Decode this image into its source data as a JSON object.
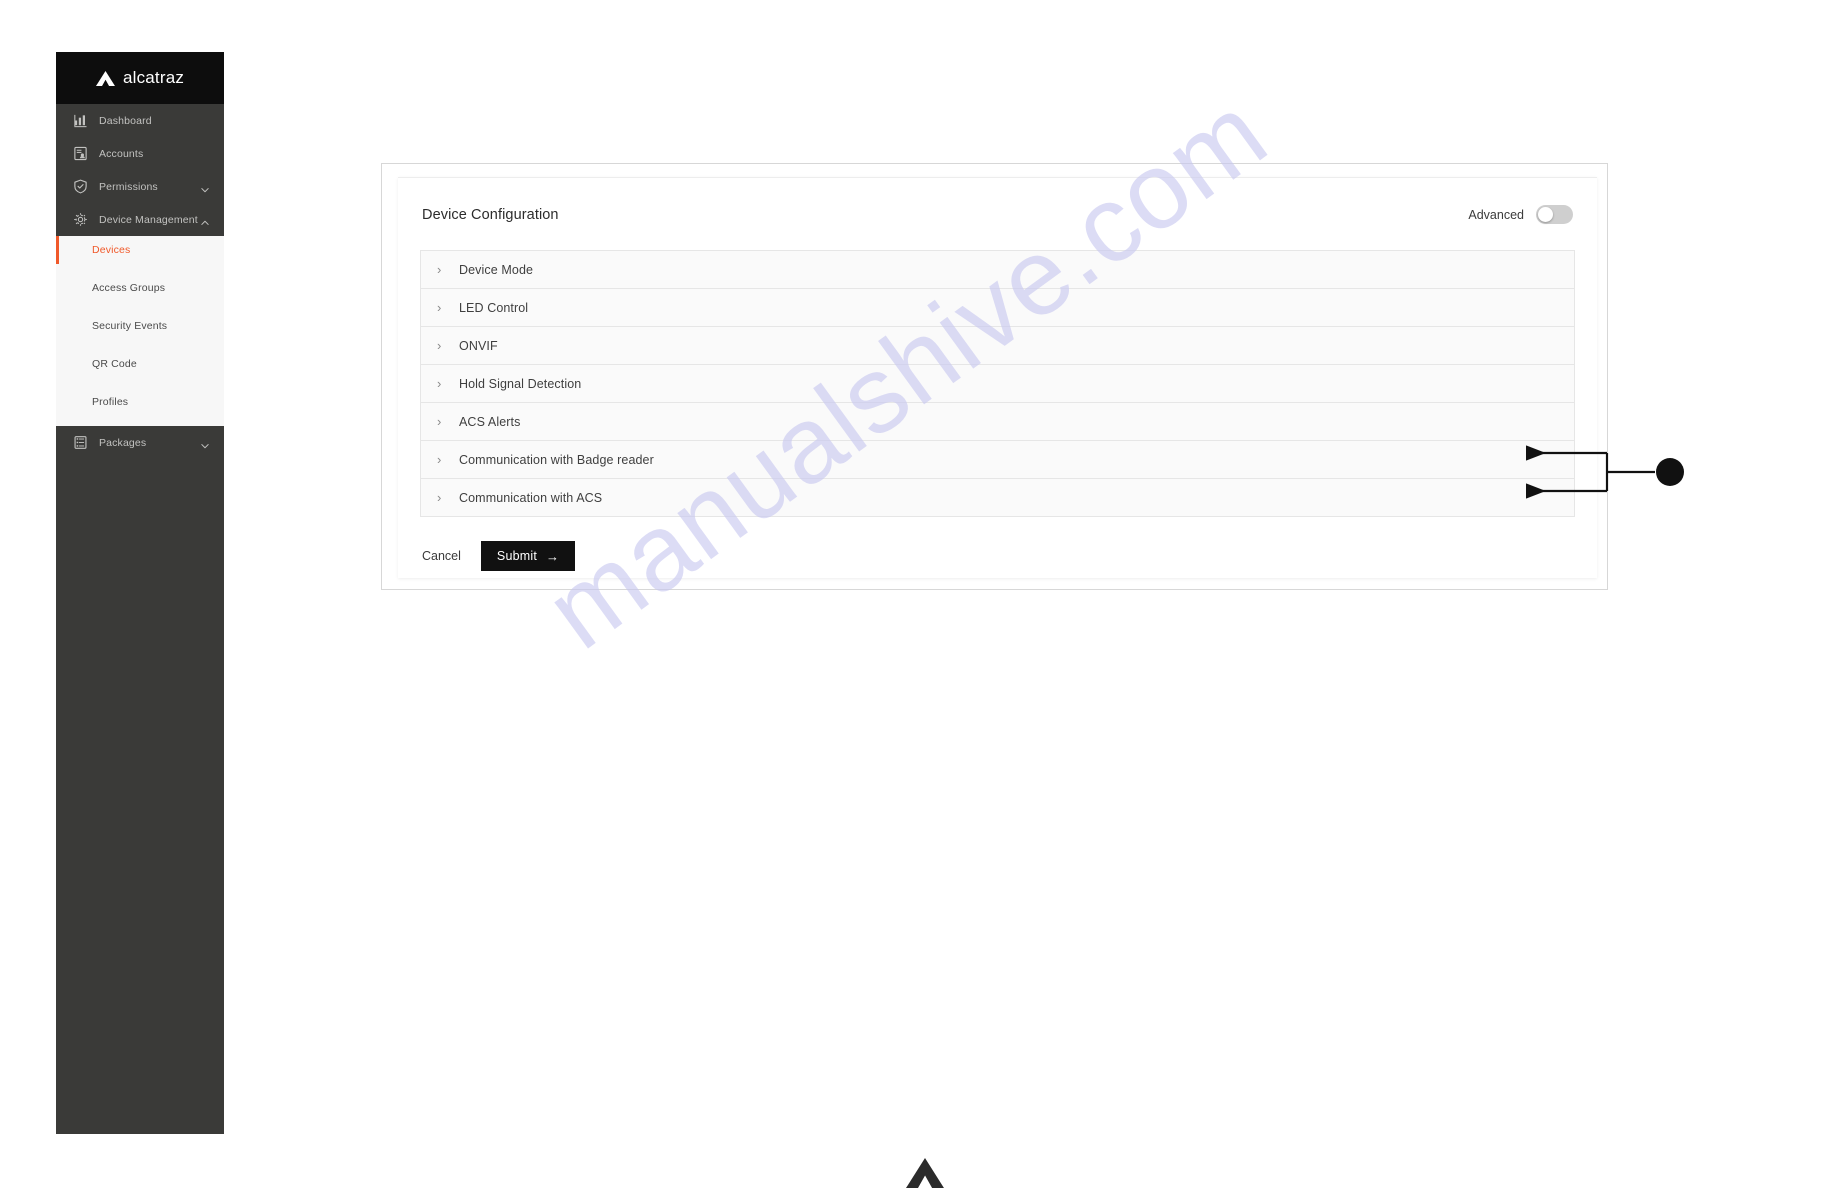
{
  "brand": {
    "name": "alcatraz",
    "logo_icon": "alcatraz-a-mark"
  },
  "watermark": {
    "text": "manualshive.com",
    "color": "#c8c8f0"
  },
  "sidebar": {
    "items": [
      {
        "label": "Dashboard",
        "icon": "bar-chart-icon",
        "caret": "",
        "name": "dashboard"
      },
      {
        "label": "Accounts",
        "icon": "account-card-icon",
        "caret": "",
        "name": "accounts"
      },
      {
        "label": "Permissions",
        "icon": "shield-check-icon",
        "caret": "⌄",
        "name": "permissions"
      },
      {
        "label": "Device Management",
        "icon": "gear-icon",
        "caret": "⌃",
        "name": "device-management"
      }
    ],
    "submenu": [
      {
        "label": "Devices",
        "active": true,
        "name": "devices"
      },
      {
        "label": "Access Groups",
        "active": false,
        "name": "access-groups"
      },
      {
        "label": "Security Events",
        "active": false,
        "name": "security-events"
      },
      {
        "label": "QR Code",
        "active": false,
        "name": "qr-code"
      },
      {
        "label": "Profiles",
        "active": false,
        "name": "profiles"
      }
    ],
    "packages": {
      "label": "Packages",
      "icon": "stack-list-icon",
      "caret": "⌄",
      "name": "packages"
    },
    "active_color": "#f0592a"
  },
  "card": {
    "title": "Device Configuration",
    "advanced": {
      "label": "Advanced",
      "enabled": false
    },
    "sections": [
      {
        "label": "Device Mode",
        "expanded": false
      },
      {
        "label": "LED Control",
        "expanded": false
      },
      {
        "label": "ONVIF",
        "expanded": false
      },
      {
        "label": "Hold Signal Detection",
        "expanded": false
      },
      {
        "label": "ACS Alerts",
        "expanded": false
      },
      {
        "label": "Communication with Badge reader",
        "expanded": false
      },
      {
        "label": "Communication with ACS",
        "expanded": false
      }
    ],
    "chevron": "›",
    "footer": {
      "cancel_label": "Cancel",
      "submit_label": "Submit",
      "submit_arrow": "→"
    }
  },
  "annotation": {
    "callout_label": "",
    "targets": [
      "Communication with Badge reader",
      "Communication with ACS"
    ]
  },
  "footer_logo": {
    "icon": "alcatraz-a-mark"
  }
}
